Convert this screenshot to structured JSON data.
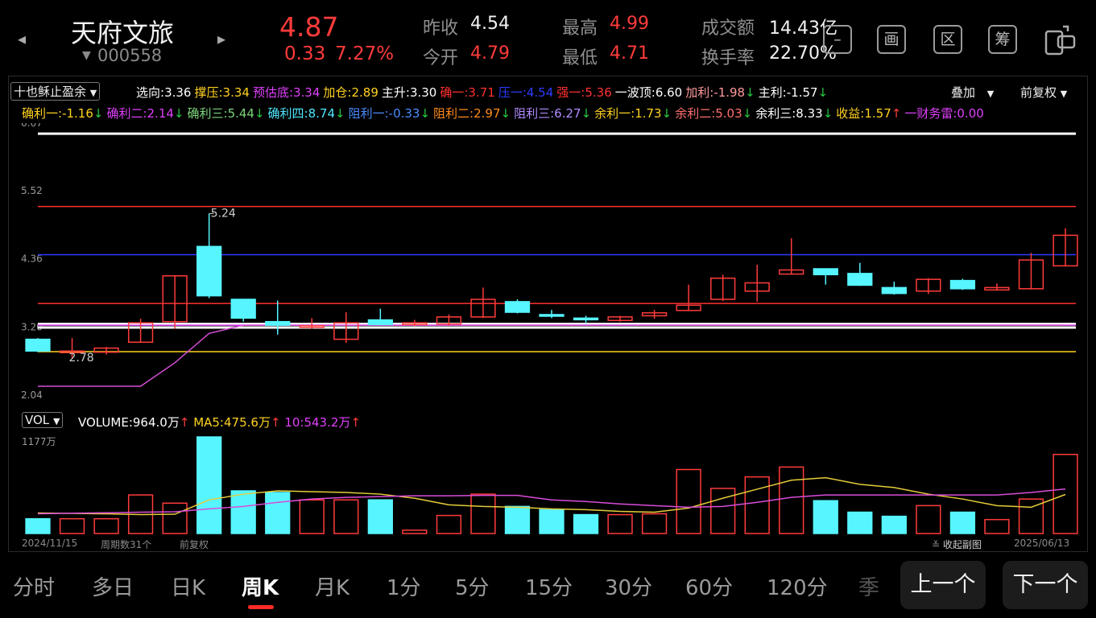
{
  "stock": {
    "name": "天府文旅",
    "code": "000558",
    "price": "4.87",
    "change": "0.33",
    "change_pct": "7.27%"
  },
  "quote": {
    "prev_close_label": "昨收",
    "prev_close": "4.54",
    "open_label": "今开",
    "open": "4.79",
    "high_label": "最高",
    "high": "4.99",
    "low_label": "最低",
    "low": "4.71",
    "amount_label": "成交额",
    "amount": "14.43亿",
    "turnover_label": "换手率",
    "turnover": "22.70%"
  },
  "toolbar": {
    "btn_minus": "–",
    "btn_draw": "画",
    "btn_zone": "区",
    "btn_chip": "筹"
  },
  "indicator": {
    "selector": "十也稣止盈余",
    "row1": [
      {
        "label": "选向:",
        "value": "3.36",
        "color": "#ffffff"
      },
      {
        "label": "撑压:",
        "value": "3.34",
        "color": "#ffd21f"
      },
      {
        "label": "预估底:",
        "value": "3.34",
        "color": "#e040fb"
      },
      {
        "label": "加仓:",
        "value": "2.89",
        "color": "#ffd21f"
      },
      {
        "label": "主升:",
        "value": "3.30",
        "color": "#ffffff"
      },
      {
        "label": "确一:",
        "value": "3.71",
        "color": "#ff3030"
      },
      {
        "label": "压一:",
        "value": "4.54",
        "color": "#2c3cff"
      },
      {
        "label": "强一:",
        "value": "5.36",
        "color": "#ff3030"
      },
      {
        "label": "一波顶:",
        "value": "6.60",
        "color": "#ffffff"
      },
      {
        "label": "加利:",
        "value": "-1.98",
        "color": "#ff9a9a",
        "arrow": "↓"
      },
      {
        "label": "主利:",
        "value": "-1.57",
        "color": "#ffffff",
        "arrow": "↓"
      }
    ],
    "overlay": "叠加",
    "adjust": "前复权",
    "row2": [
      {
        "label": "确利一:",
        "value": "-1.16",
        "color": "#ffd21f",
        "arrow": "↓"
      },
      {
        "label": "确利二:",
        "value": "2.14",
        "color": "#e040fb",
        "arrow": "↓"
      },
      {
        "label": "确利三:",
        "value": "5.44",
        "color": "#7cd67c",
        "arrow": "↓"
      },
      {
        "label": "确利四:",
        "value": "8.74",
        "color": "#4fe8ff",
        "arrow": "↓"
      },
      {
        "label": "阻利一:",
        "value": "-0.33",
        "color": "#4b8dff",
        "arrow": "↓"
      },
      {
        "label": "阻利二:",
        "value": "2.97",
        "color": "#ff8c1a",
        "arrow": "↓"
      },
      {
        "label": "阻利三:",
        "value": "6.27",
        "color": "#b38cff",
        "arrow": "↓"
      },
      {
        "label": "余利一:",
        "value": "1.73",
        "color": "#ffd21f",
        "arrow": "↓"
      },
      {
        "label": "余利二:",
        "value": "5.03",
        "color": "#ff7070",
        "arrow": "↓"
      },
      {
        "label": "余利三:",
        "value": "8.33",
        "color": "#ffffff",
        "arrow": "↓"
      },
      {
        "label": "收益:",
        "value": "1.57",
        "color": "#ffd21f",
        "arrow": "↑"
      },
      {
        "label": "一财务雷:",
        "value": "0.00",
        "color": "#e040fb",
        "arrow": ""
      }
    ]
  },
  "axis": {
    "y_top": "6.67",
    "y_2": "5.52",
    "y_3": "4.36",
    "y_4": "3.20",
    "y_bottom": "2.04",
    "high_mark": "5.24",
    "low_mark": "2.78"
  },
  "volume": {
    "selector": "VOL",
    "vol_label": "VOLUME:",
    "vol_value": "964.0万",
    "ma5_label": "MA5:",
    "ma5_value": "475.6万",
    "ma10_label": "10:",
    "ma10_value": "543.2万",
    "max_label": "1177万"
  },
  "footer": {
    "start_date": "2024/11/15",
    "period_count": "周期数31个",
    "adjust": "前复权",
    "collapse": "收起副图",
    "end_date": "2025/06/13"
  },
  "tabs": [
    "分时",
    "多日",
    "日K",
    "周K",
    "月K",
    "1分",
    "5分",
    "15分",
    "30分",
    "60分",
    "120分",
    "季"
  ],
  "active_tab": "周K",
  "nav": {
    "prev": "上一个",
    "next": "下一个"
  },
  "colors": {
    "up": "#ff3b3b",
    "down": "#56f5ff",
    "ma5": "#e6cc3a",
    "ma10": "#d94dd9"
  },
  "chart_data": {
    "type": "candlestick",
    "ylim": [
      2.04,
      6.67
    ],
    "candles": [
      [
        3.1,
        2.9,
        3.12,
        2.88
      ],
      [
        2.88,
        2.9,
        3.12,
        2.78
      ],
      [
        2.88,
        2.95,
        2.97,
        2.84
      ],
      [
        3.05,
        3.38,
        3.45,
        3.05
      ],
      [
        3.4,
        4.18,
        4.18,
        3.28
      ],
      [
        4.68,
        3.84,
        5.24,
        3.8
      ],
      [
        3.78,
        3.46,
        3.78,
        3.4
      ],
      [
        3.4,
        3.34,
        3.76,
        3.18
      ],
      [
        3.33,
        3.33,
        3.46,
        3.28
      ],
      [
        3.1,
        3.38,
        3.56,
        3.04
      ],
      [
        3.43,
        3.35,
        3.62,
        3.34
      ],
      [
        3.35,
        3.38,
        3.43,
        3.32
      ],
      [
        3.36,
        3.48,
        3.52,
        3.33
      ],
      [
        3.48,
        3.78,
        3.98,
        3.46
      ],
      [
        3.74,
        3.56,
        3.78,
        3.54
      ],
      [
        3.52,
        3.5,
        3.6,
        3.46
      ],
      [
        3.46,
        3.45,
        3.5,
        3.37
      ],
      [
        3.42,
        3.48,
        3.5,
        3.4
      ],
      [
        3.5,
        3.55,
        3.6,
        3.45
      ],
      [
        3.59,
        3.68,
        4.03,
        3.58
      ],
      [
        3.78,
        4.14,
        4.2,
        3.75
      ],
      [
        3.92,
        4.06,
        4.37,
        3.74
      ],
      [
        4.21,
        4.28,
        4.82,
        4.2
      ],
      [
        4.3,
        4.2,
        4.3,
        4.03
      ],
      [
        4.22,
        4.02,
        4.4,
        4.01
      ],
      [
        3.98,
        3.88,
        4.08,
        3.86
      ],
      [
        3.92,
        4.12,
        4.14,
        3.87
      ],
      [
        4.1,
        3.96,
        4.13,
        3.94
      ],
      [
        3.94,
        3.98,
        4.05,
        3.93
      ],
      [
        3.96,
        4.45,
        4.57,
        3.95
      ],
      [
        4.35,
        4.87,
        4.99,
        4.34
      ]
    ],
    "volume": [
      180,
      180,
      180,
      470,
      370,
      1177,
      520,
      500,
      410,
      410,
      410,
      40,
      220,
      480,
      330,
      290,
      230,
      230,
      240,
      780,
      550,
      690,
      810,
      400,
      260,
      210,
      340,
      260,
      170,
      420,
      964
    ],
    "ma5": [
      250,
      245,
      240,
      230,
      235,
      410,
      480,
      520,
      510,
      500,
      480,
      430,
      350,
      330,
      320,
      300,
      290,
      270,
      260,
      310,
      430,
      540,
      650,
      680,
      600,
      560,
      480,
      420,
      340,
      320,
      475.6
    ],
    "ma10": [
      240,
      248,
      253,
      260,
      265,
      300,
      330,
      380,
      420,
      440,
      450,
      460,
      460,
      465,
      465,
      410,
      390,
      360,
      340,
      320,
      330,
      380,
      440,
      470,
      470,
      470,
      470,
      470,
      470,
      500,
      543.2
    ],
    "hlines": [
      {
        "value": 6.6,
        "color": "#ffffff"
      },
      {
        "value": 5.36,
        "color": "#ff3030"
      },
      {
        "value": 4.54,
        "color": "#2c3cff"
      },
      {
        "value": 3.71,
        "color": "#ff3030"
      },
      {
        "value": 3.36,
        "color": "#ffffff"
      },
      {
        "value": 3.3,
        "color": "#ffffff"
      },
      {
        "value": 3.34,
        "color": "#e040fb"
      },
      {
        "value": 2.89,
        "color": "#ffd21f"
      }
    ],
    "pink_curve": [
      2.3,
      2.3,
      2.3,
      2.3,
      2.7,
      3.2,
      3.34,
      3.34,
      3.34,
      3.34,
      3.34,
      3.34,
      3.34,
      3.34,
      3.34,
      3.34,
      3.34,
      3.34,
      3.34,
      3.34,
      3.34,
      3.34,
      3.34,
      3.34,
      3.34,
      3.34,
      3.34,
      3.34,
      3.34,
      3.34,
      3.34
    ]
  }
}
